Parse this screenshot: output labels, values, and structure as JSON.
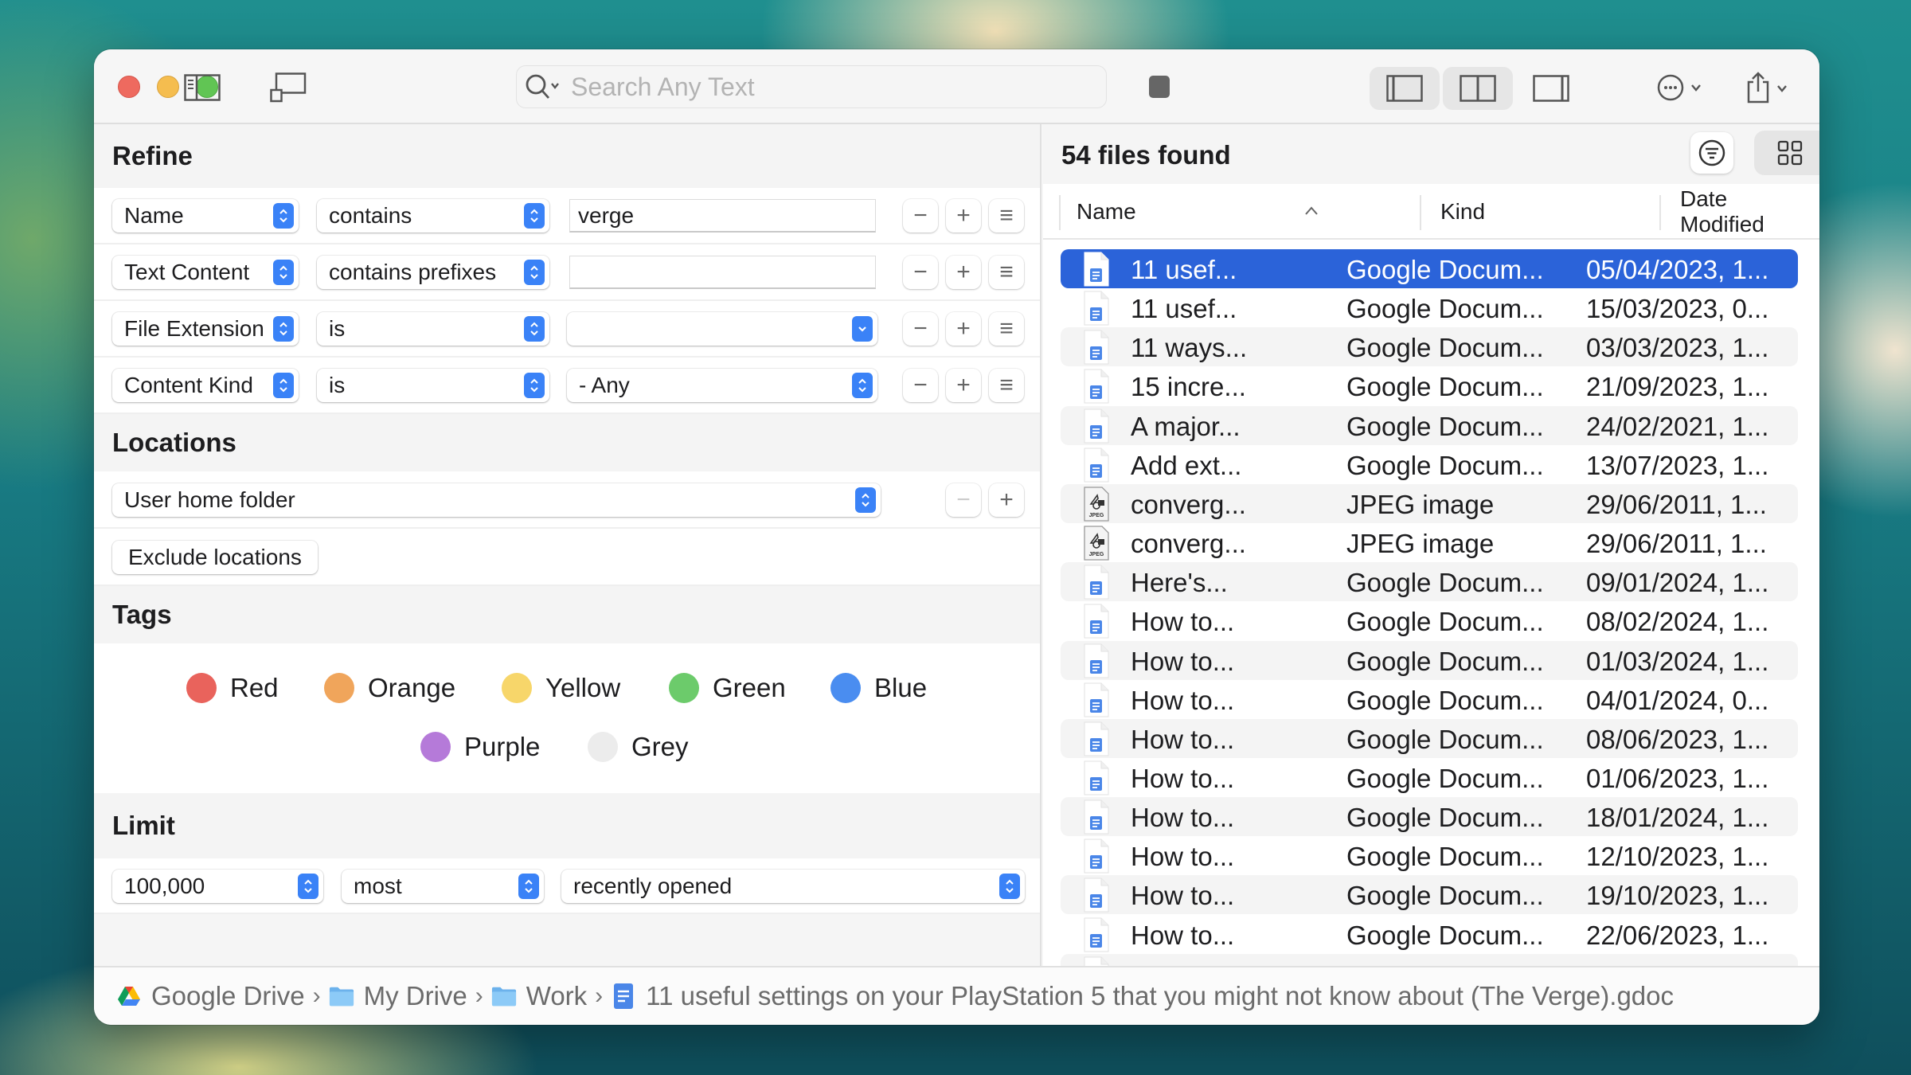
{
  "toolbar": {
    "search_placeholder": "Search Any Text",
    "search_value": ""
  },
  "refine": {
    "title": "Refine",
    "criteria": [
      {
        "attribute": "Name",
        "operator": "contains",
        "value": "verge",
        "value_type": "text"
      },
      {
        "attribute": "Text Content",
        "operator": "contains prefixes",
        "value": "",
        "value_type": "text"
      },
      {
        "attribute": "File Extension",
        "operator": "is",
        "value": "",
        "value_type": "combo"
      },
      {
        "attribute": "Content Kind",
        "operator": "is",
        "value": "- Any",
        "value_type": "popup"
      }
    ],
    "buttons": {
      "remove": "−",
      "add": "+",
      "more": "≡"
    }
  },
  "locations": {
    "title": "Locations",
    "selected": "User home folder",
    "exclude_label": "Exclude locations",
    "remove": "−",
    "add": "+"
  },
  "tags": {
    "title": "Tags",
    "items": [
      {
        "label": "Red",
        "color": "#e9635c"
      },
      {
        "label": "Orange",
        "color": "#f0a55b"
      },
      {
        "label": "Yellow",
        "color": "#f7d66a"
      },
      {
        "label": "Green",
        "color": "#6ccb6b"
      },
      {
        "label": "Blue",
        "color": "#4a8df0"
      },
      {
        "label": "Purple",
        "color": "#b57ad9"
      },
      {
        "label": "Grey",
        "color": "#ececec"
      }
    ]
  },
  "limit": {
    "title": "Limit",
    "count": "100,000",
    "order": "most",
    "criterion": "recently opened"
  },
  "results": {
    "count_label": "54 files found",
    "columns": {
      "name": "Name",
      "kind": "Kind",
      "date": "Date Modified"
    },
    "sort_indicator": "^",
    "rows": [
      {
        "name": "11 usef...",
        "kind": "Google Docum...",
        "date": "05/04/2023, 1...",
        "icon": "gdoc",
        "selected": true
      },
      {
        "name": "11 usef...",
        "kind": "Google Docum...",
        "date": "15/03/2023, 0...",
        "icon": "gdoc"
      },
      {
        "name": "11 ways...",
        "kind": "Google Docum...",
        "date": "03/03/2023, 1...",
        "icon": "gdoc"
      },
      {
        "name": "15 incre...",
        "kind": "Google Docum...",
        "date": "21/09/2023, 1...",
        "icon": "gdoc"
      },
      {
        "name": "A major...",
        "kind": "Google Docum...",
        "date": "24/02/2021, 1...",
        "icon": "gdoc"
      },
      {
        "name": "Add ext...",
        "kind": "Google Docum...",
        "date": "13/07/2023, 1...",
        "icon": "gdoc"
      },
      {
        "name": "converg...",
        "kind": "JPEG image",
        "date": "29/06/2011, 1...",
        "icon": "jpeg"
      },
      {
        "name": "converg...",
        "kind": "JPEG image",
        "date": "29/06/2011, 1...",
        "icon": "jpeg"
      },
      {
        "name": "Here's...",
        "kind": "Google Docum...",
        "date": "09/01/2024, 1...",
        "icon": "gdoc"
      },
      {
        "name": "How to...",
        "kind": "Google Docum...",
        "date": "08/02/2024, 1...",
        "icon": "gdoc"
      },
      {
        "name": "How to...",
        "kind": "Google Docum...",
        "date": "01/03/2024, 1...",
        "icon": "gdoc"
      },
      {
        "name": "How to...",
        "kind": "Google Docum...",
        "date": "04/01/2024, 0...",
        "icon": "gdoc"
      },
      {
        "name": "How to...",
        "kind": "Google Docum...",
        "date": "08/06/2023, 1...",
        "icon": "gdoc"
      },
      {
        "name": "How to...",
        "kind": "Google Docum...",
        "date": "01/06/2023, 1...",
        "icon": "gdoc"
      },
      {
        "name": "How to...",
        "kind": "Google Docum...",
        "date": "18/01/2024, 1...",
        "icon": "gdoc"
      },
      {
        "name": "How to...",
        "kind": "Google Docum...",
        "date": "12/10/2023, 1...",
        "icon": "gdoc"
      },
      {
        "name": "How to...",
        "kind": "Google Docum...",
        "date": "19/10/2023, 1...",
        "icon": "gdoc"
      },
      {
        "name": "How to...",
        "kind": "Google Docum...",
        "date": "22/06/2023, 1...",
        "icon": "gdoc"
      },
      {
        "name": "",
        "kind": "",
        "date": "",
        "icon": "gdoc"
      }
    ]
  },
  "statusbar": {
    "path": [
      {
        "label": "Google Drive",
        "icon": "google-drive-icon"
      },
      {
        "label": "My Drive",
        "icon": "folder-icon"
      },
      {
        "label": "Work",
        "icon": "folder-icon"
      },
      {
        "label": "11 useful settings on your PlayStation 5 that you might not know about (The Verge).gdoc",
        "icon": "google-doc-icon"
      }
    ],
    "separator": "›"
  },
  "colors": {
    "accent": "#2b63d9",
    "stepper": "#3a82f7",
    "gdoc_blue": "#4a86e8"
  }
}
